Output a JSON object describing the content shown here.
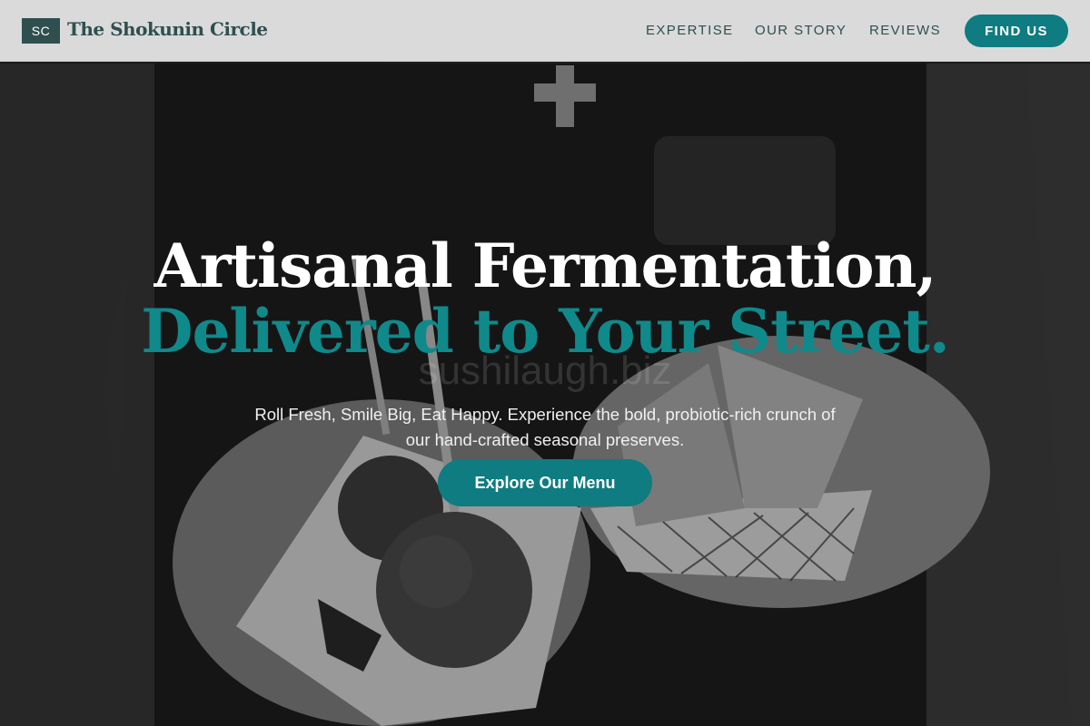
{
  "nav": {
    "logo_badge": "SC",
    "brand": "The Shokunin Circle",
    "links": [
      "EXPERTISE",
      "OUR STORY",
      "REVIEWS"
    ],
    "cta": "FIND US"
  },
  "hero": {
    "headline_line1": "Artisanal Fermentation,",
    "headline_line2": "Delivered to Your Street.",
    "watermark": "sushilaugh.biz",
    "subtitle": "Roll Fresh, Smile Big, Eat Happy. Experience the bold, probiotic-rich crunch of our hand-crafted seasonal preserves.",
    "cta": "Explore Our Menu"
  },
  "colors": {
    "accent": "#0e7c80",
    "headline_accent": "#10898b",
    "brand_dark": "#2f4f4f",
    "nav_bg": "#e2e2e2"
  }
}
